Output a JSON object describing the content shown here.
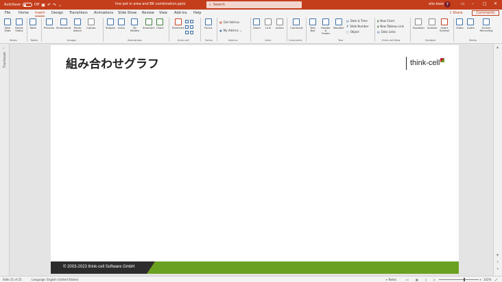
{
  "titlebar": {
    "autosave_label": "AutoSave",
    "autosave_state": "Off",
    "filename": "line pot in area and BK combination.pptx",
    "search_placeholder": "Search",
    "user": "alia kaze",
    "avatar_initial": "T",
    "colors": {
      "accent": "#c43e1c"
    }
  },
  "menu": {
    "tabs": [
      "File",
      "Home",
      "Insert",
      "Design",
      "Transitions",
      "Animations",
      "Slide Show",
      "Review",
      "View",
      "Add-ins",
      "Help"
    ],
    "active_tab": "Insert",
    "share": "Share",
    "comments": "Comments"
  },
  "ribbon": {
    "items": {
      "new_slide": "New Slide",
      "reuse_slides": "Reuse Slides",
      "table": "Table",
      "pictures": "Pictures",
      "screenshot": "Screenshot",
      "photo_album": "Photo Album",
      "cameo": "Cameo",
      "shapes": "Shapes",
      "icons": "Icons",
      "models_3d": "3D Models",
      "smartart": "SmartArt",
      "chart": "Chart",
      "elements": "Elements",
      "forms": "Forms",
      "get_addins": "Get Add-ins",
      "my_addins": "My Add-ins",
      "zoom": "Zoom",
      "link": "Link",
      "action": "Action",
      "comment": "Comment",
      "text_box": "Text Box",
      "header_footer": "Header & Footer",
      "wordart": "WordArt",
      "date_time": "Date & Time",
      "slide_number": "Slide Number",
      "object": "Object",
      "new_chart": "New Chart",
      "new_tableau": "New Tableau Link",
      "data_links": "Data Links",
      "equation": "Equation",
      "symbol": "Symbol",
      "insert_symbol": "Insert Symbol",
      "video": "Video",
      "audio": "Audio",
      "screen_recording": "Screen Recording"
    },
    "groups": [
      "Slides",
      "Tables",
      "Images",
      "Illustrations",
      "think-cell",
      "Forms",
      "Add-ins",
      "Links",
      "Comments",
      "Text",
      "think-cell Data",
      "Symbols",
      "Media"
    ]
  },
  "thumbnails": {
    "label": "Thumbnails"
  },
  "slide": {
    "title": "組み合わせグラフ",
    "logo_text": "think-cell",
    "footer": "© 2003-2023 think-cell Software GmbH",
    "colors": {
      "footer_dark": "#2c2c2c",
      "footer_red": "#c8102e",
      "footer_green": "#6aa121"
    }
  },
  "status": {
    "slide_counter": "Slide 21 of 25",
    "accessibility": "Language: English (United States)",
    "notes": "Notes",
    "zoom": "102%"
  }
}
